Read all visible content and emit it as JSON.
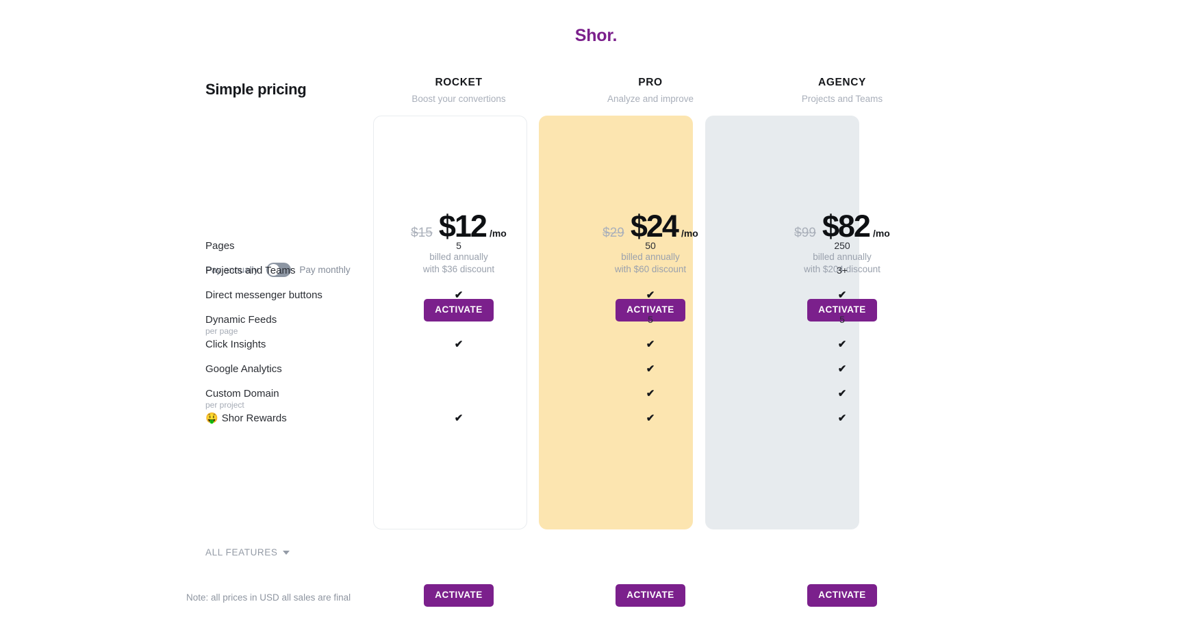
{
  "brand": {
    "name": "Shor.",
    "color": "#7b208c"
  },
  "sidebar": {
    "title": "Simple pricing",
    "toggle": {
      "left_label": "Pay annually",
      "right_label": "Pay monthly",
      "state": "annually"
    },
    "all_features_label": "ALL FEATURES",
    "note": "Note: all prices in USD all sales are final"
  },
  "plans": [
    {
      "name": "ROCKET",
      "tagline": "Boost your convertions",
      "old_price": "$15",
      "price": "$12",
      "per": "/mo",
      "billed_line1": "billed annually",
      "billed_line2": "with $36 discount",
      "cta": "ACTIVATE",
      "card_bg": "#ffffff"
    },
    {
      "name": "PRO",
      "tagline": "Analyze and improve",
      "old_price": "$29",
      "price": "$24",
      "per": "/mo",
      "billed_line1": "billed annually",
      "billed_line2": "with $60 discount",
      "cta": "ACTIVATE",
      "card_bg": "#fce5b0"
    },
    {
      "name": "AGENCY",
      "tagline": "Projects and Teams",
      "old_price": "$99",
      "price": "$82",
      "per": "/mo",
      "billed_line1": "billed annually",
      "billed_line2": "with $204 discount",
      "cta": "ACTIVATE",
      "card_bg": "#e7ebee"
    }
  ],
  "features": [
    {
      "label": "Pages",
      "sub": "",
      "emoji": "",
      "values": [
        "5",
        "50",
        "250"
      ]
    },
    {
      "label": "Projects and Teams",
      "sub": "",
      "emoji": "",
      "values": [
        "",
        "",
        "3+"
      ]
    },
    {
      "label": "Direct messenger buttons",
      "sub": "",
      "emoji": "",
      "values": [
        "✔",
        "✔",
        "✔"
      ]
    },
    {
      "label": "Dynamic Feeds",
      "sub": "per page",
      "emoji": "",
      "values": [
        "",
        "5",
        "5"
      ]
    },
    {
      "label": "Click Insights",
      "sub": "",
      "emoji": "",
      "values": [
        "✔",
        "✔",
        "✔"
      ]
    },
    {
      "label": "Google Analytics",
      "sub": "",
      "emoji": "",
      "values": [
        "",
        "✔",
        "✔"
      ]
    },
    {
      "label": "Custom Domain",
      "sub": "per project",
      "emoji": "",
      "values": [
        "",
        "✔",
        "✔"
      ]
    },
    {
      "label": "Shor Rewards",
      "sub": "",
      "emoji": "🤑",
      "values": [
        "✔",
        "✔",
        "✔"
      ]
    }
  ]
}
